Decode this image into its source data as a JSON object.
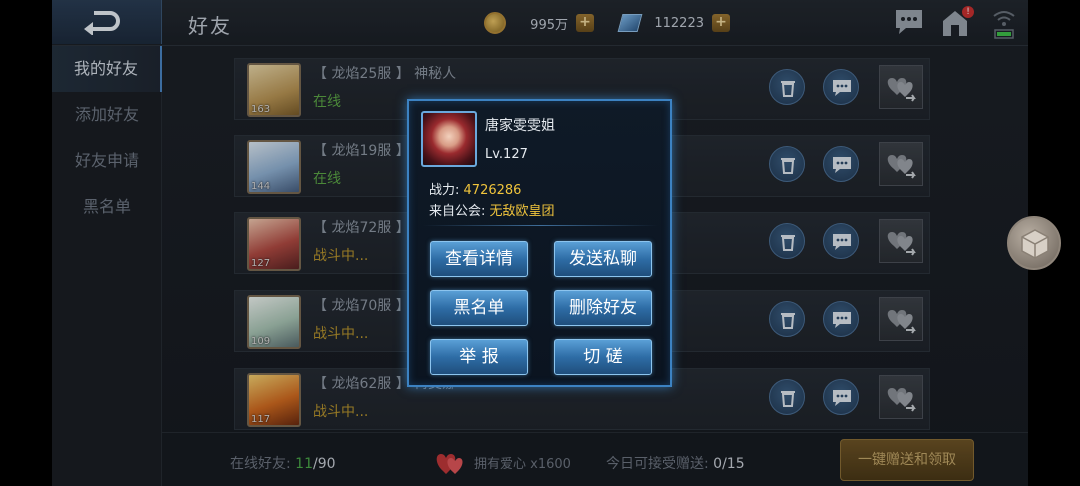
{
  "topbar": {
    "title": "好友",
    "gold": "995万",
    "diamond": "112223",
    "plus": "+",
    "mail_badge": "!"
  },
  "sidebar": {
    "items": [
      {
        "label": "我的好友",
        "active": true
      },
      {
        "label": "添加好友",
        "active": false
      },
      {
        "label": "好友申请",
        "active": false
      },
      {
        "label": "黑名单",
        "active": false
      }
    ]
  },
  "friends": [
    {
      "name": "【 龙焰25服 】 神秘人",
      "status": "在线",
      "level": "163"
    },
    {
      "name": "【 龙焰19服 】",
      "status": "在线",
      "level": "144"
    },
    {
      "name": "【 龙焰72服 】",
      "status": "战斗中...",
      "level": "127"
    },
    {
      "name": "【 龙焰70服 】",
      "status": "战斗中...",
      "level": "109"
    },
    {
      "name": "【 龙焰62服 】 梅艾娜",
      "status": "战斗中...",
      "level": "117"
    }
  ],
  "bottom": {
    "online_label": "在线好友:",
    "online_count": "11",
    "online_total": "/90",
    "hearts": "拥有爱心 x1600",
    "gift_label": "今日可接受赠送:",
    "gift_count": "0/15",
    "claim_button": "一键赠送和领取"
  },
  "popup": {
    "name": "唐家雯雯姐",
    "level": "Lv.127",
    "power_label": "战力:",
    "power_value": "4726286",
    "guild_label": "来自公会:",
    "guild_value": "无敌欧皇团",
    "buttons": {
      "details": "查看详情",
      "message": "发送私聊",
      "blacklist": "黑名单",
      "delete": "删除好友",
      "report": "举  报",
      "spar": "切  磋"
    }
  },
  "colors": {
    "accent": "#3c82c2",
    "online": "#5ca646",
    "fighting": "#b8942e",
    "highlight": "#f0c43c"
  },
  "icons": [
    "back-arrow-icon",
    "gold-coin-icon",
    "diamond-icon",
    "chat-icon",
    "mail-icon",
    "wifi-battery-icon",
    "trash-icon",
    "message-icon",
    "gift-heart-icon",
    "heart-icon",
    "cube-icon"
  ]
}
